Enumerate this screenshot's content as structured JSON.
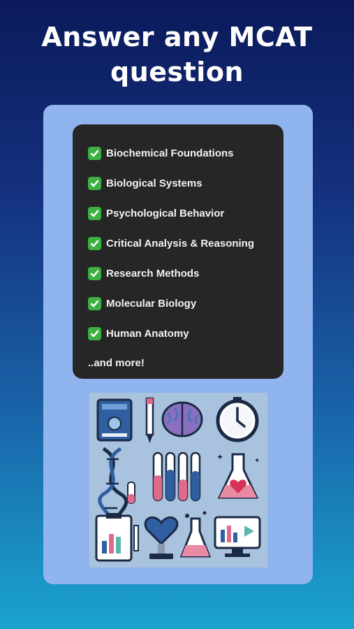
{
  "headline": "Answer any MCAT question",
  "topics": [
    {
      "label": "Biochemical Foundations"
    },
    {
      "label": "Biological Systems"
    },
    {
      "label": "Psychological Behavior"
    },
    {
      "label": "Critical Analysis & Reasoning"
    },
    {
      "label": "Research Methods"
    },
    {
      "label": "Molecular Biology"
    },
    {
      "label": "Human Anatomy"
    }
  ],
  "more_text": "..and more!",
  "icons": [
    "book-icon",
    "pencil-icon",
    "brain-icon",
    "stopwatch-icon",
    "dna-icon",
    "test-tubes-icon",
    "flask-heart-icon",
    "clipboard-chart-icon",
    "heart-trophy-icon",
    "beaker-icon",
    "monitor-chart-icon"
  ],
  "colors": {
    "check_green": "#3cb043",
    "panel_dark": "#262626",
    "card_blue": "#8fb4ee",
    "gradient_top": "#0b1a5a",
    "gradient_bottom": "#1aa3cf"
  }
}
